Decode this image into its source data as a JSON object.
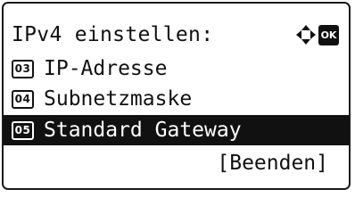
{
  "screen": {
    "title": "IPv4 einstellen:",
    "ok_label": "OK",
    "nav_icon": "four-way-arrow-icon",
    "menu_items": [
      {
        "number": "03",
        "label": "IP-Adresse",
        "selected": false
      },
      {
        "number": "04",
        "label": "Subnetzmaske",
        "selected": false
      },
      {
        "number": "05",
        "label": "Standard Gateway",
        "selected": true
      }
    ],
    "end_label": "[Beenden]"
  }
}
